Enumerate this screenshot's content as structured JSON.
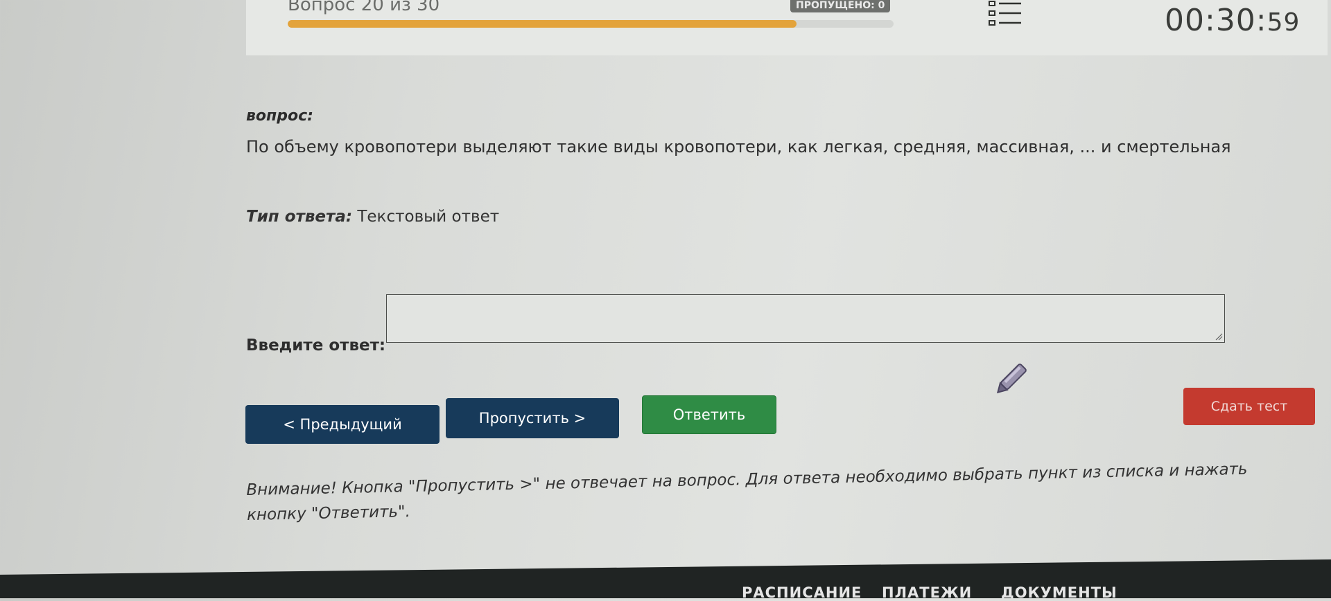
{
  "header": {
    "progress_caption": "Вопрос 20 из 30",
    "progress_fraction": 0.84,
    "skipped_label": "ПРОПУЩЕНО: 0",
    "timer_main": "00:30:",
    "timer_seconds": "59"
  },
  "question": {
    "label": "вопрос:",
    "text": "По объему кровопотери выделяют такие виды кровопотери, как легкая, средняя, массивная, ... и смертельная",
    "type_label": "Тип ответа:",
    "type_value": " Текстовый ответ"
  },
  "answer": {
    "label": "Введите ответ:",
    "value": ""
  },
  "buttons": {
    "prev": "< Предыдущий",
    "skip": "Пропустить >",
    "answer": "Ответить",
    "submit": "Сдать тест"
  },
  "notice": "Внимание! Кнопка \"Пропустить >\" не отвечает на вопрос. Для ответа необходимо выбрать пункт из списка и нажать кнопку \"Ответить\".",
  "footer": {
    "items": [
      "РАСПИСАНИЕ",
      "ПЛАТЕЖИ",
      "ДОКУМЕНТЫ"
    ]
  },
  "colors": {
    "progress": "#e3a33b",
    "primary": "#173a5a",
    "success": "#2f8c45",
    "danger": "#c43a2f"
  }
}
